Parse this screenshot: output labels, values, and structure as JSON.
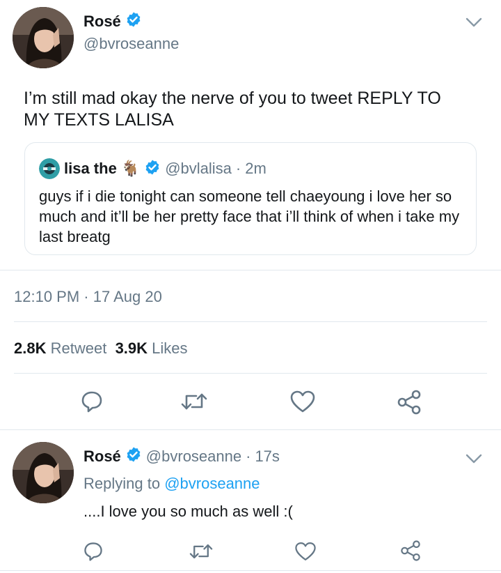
{
  "main_tweet": {
    "author_name": "Rosé",
    "author_handle": "@bvroseanne",
    "text": "I’m still mad okay the nerve of you to tweet REPLY TO MY TEXTS LALISA",
    "quoted": {
      "author_name": "lisa the",
      "author_emoji": "🐐",
      "author_handle": "@bvlalisa",
      "separator": "·",
      "time": "2m",
      "text": "guys if i die tonight can someone tell chaeyoung i love her so much and it’ll be her pretty face that i’ll think of when i take my last breatg"
    },
    "timestamp": "12:10 PM · 17 Aug 20",
    "retweets_count": "2.8K",
    "retweets_label": "Retweet",
    "likes_count": "3.9K",
    "likes_label": "Likes",
    "icons": [
      "reply-icon",
      "retweet-icon",
      "like-icon",
      "share-icon",
      "verified-badge-icon",
      "chevron-down-icon"
    ]
  },
  "reply_tweet": {
    "author_name": "Rosé",
    "author_handle": "@bvroseanne",
    "separator": "·",
    "time": "17s",
    "replying_label": "Replying to",
    "replying_to": "@bvroseanne",
    "text": "....I love you so much as well :("
  },
  "colors": {
    "verified": "#1da1f2",
    "link": "#1da1f2",
    "secondary_text": "#657786",
    "divider": "#e1e8ed",
    "primary_text": "#14171a"
  }
}
